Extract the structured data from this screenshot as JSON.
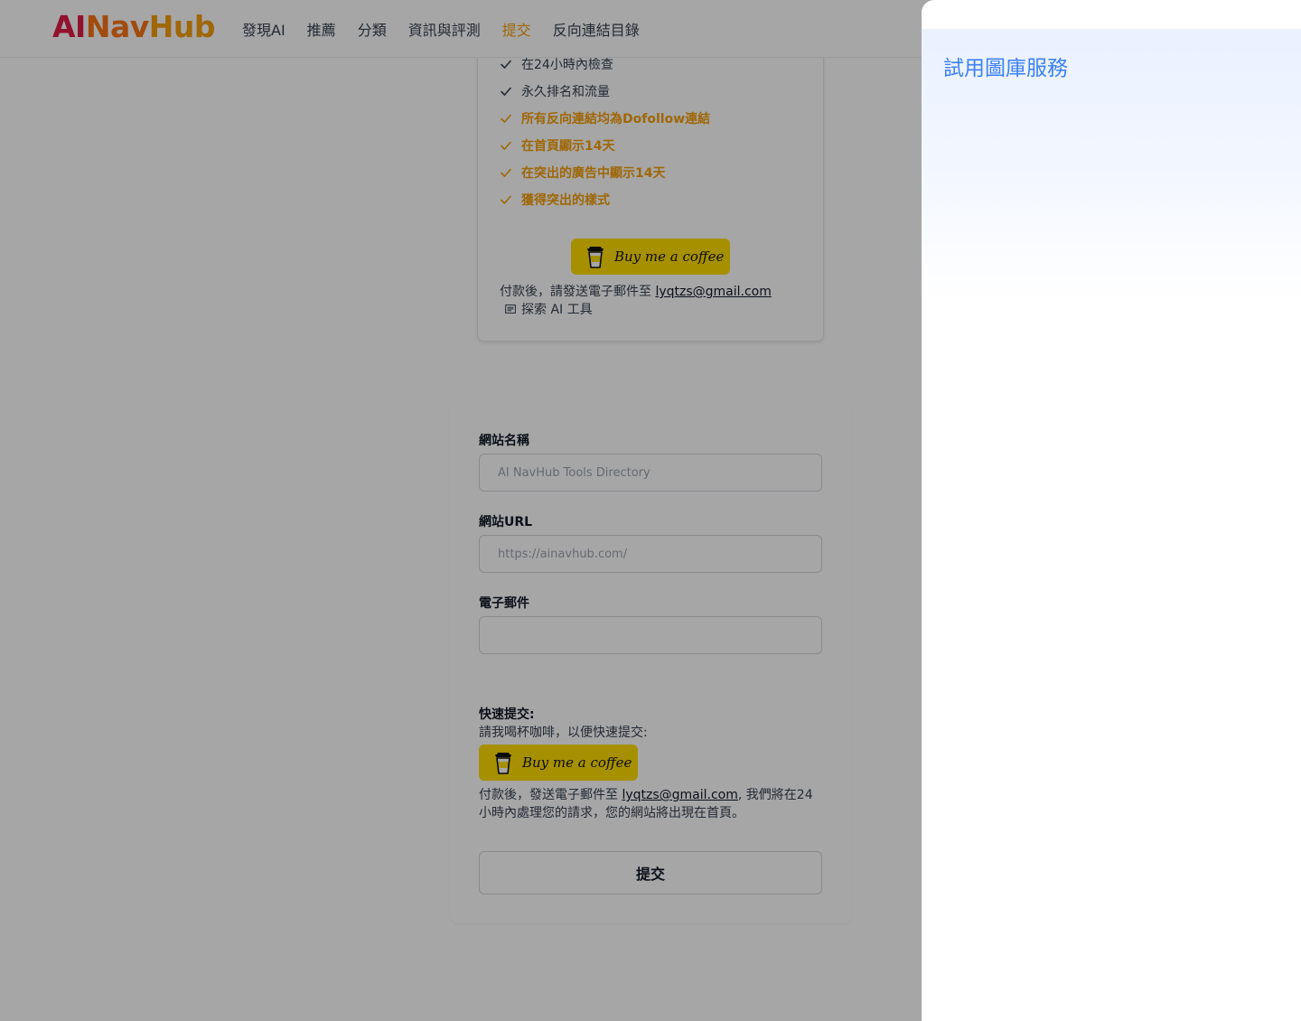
{
  "header": {
    "logo": {
      "ai": "AI",
      "nav": "Nav",
      "hub": "Hub"
    },
    "nav": [
      {
        "label": "發現AI",
        "active": false
      },
      {
        "label": "推薦",
        "active": false
      },
      {
        "label": "分類",
        "active": false
      },
      {
        "label": "資訊與評測",
        "active": false
      },
      {
        "label": "提交",
        "active": true
      },
      {
        "label": "反向連結目錄",
        "active": false
      }
    ]
  },
  "pricing": {
    "features": [
      {
        "text": "在24小時內檢查",
        "highlight": false
      },
      {
        "text": "永久排名和流量",
        "highlight": false
      },
      {
        "text": "所有反向連結均為Dofollow連結",
        "highlight": true
      },
      {
        "text": "在首頁顯示14天",
        "highlight": true
      },
      {
        "text": "在突出的廣告中顯示14天",
        "highlight": true
      },
      {
        "text": "獲得突出的樣式",
        "highlight": true
      }
    ],
    "buy_coffee_label": "Buy me a coffee",
    "pay_note_prefix": "付款後，請發送電子郵件至 ",
    "email": "lyqtzs@gmail.com",
    "explore_label": "探索 AI 工具"
  },
  "form": {
    "site_name_label": "網站名稱",
    "site_name_placeholder": "AI NavHub Tools Directory",
    "site_url_label": "網站URL",
    "site_url_placeholder": "https://ainavhub.com/",
    "email_label": "電子郵件",
    "email_value": "",
    "quick_title": "快速提交:",
    "quick_sub": "請我喝杯咖啡，以便快速提交:",
    "buy_coffee_label": "Buy me a coffee",
    "quick_note_prefix": "付款後，發送電子郵件至 ",
    "quick_email": "lyqtzs@gmail.com",
    "quick_note_suffix": ", 我們將在24小時內處理您的請求，您的網站將出現在首頁。",
    "submit_label": "提交"
  },
  "drawer": {
    "title": "試用圖庫服務"
  },
  "colors": {
    "accent": "#f59e0b",
    "coffee_yellow": "#ffdd00",
    "drawer_title": "#3b82f6",
    "overlay": "rgba(0,0,0,0.35)"
  }
}
